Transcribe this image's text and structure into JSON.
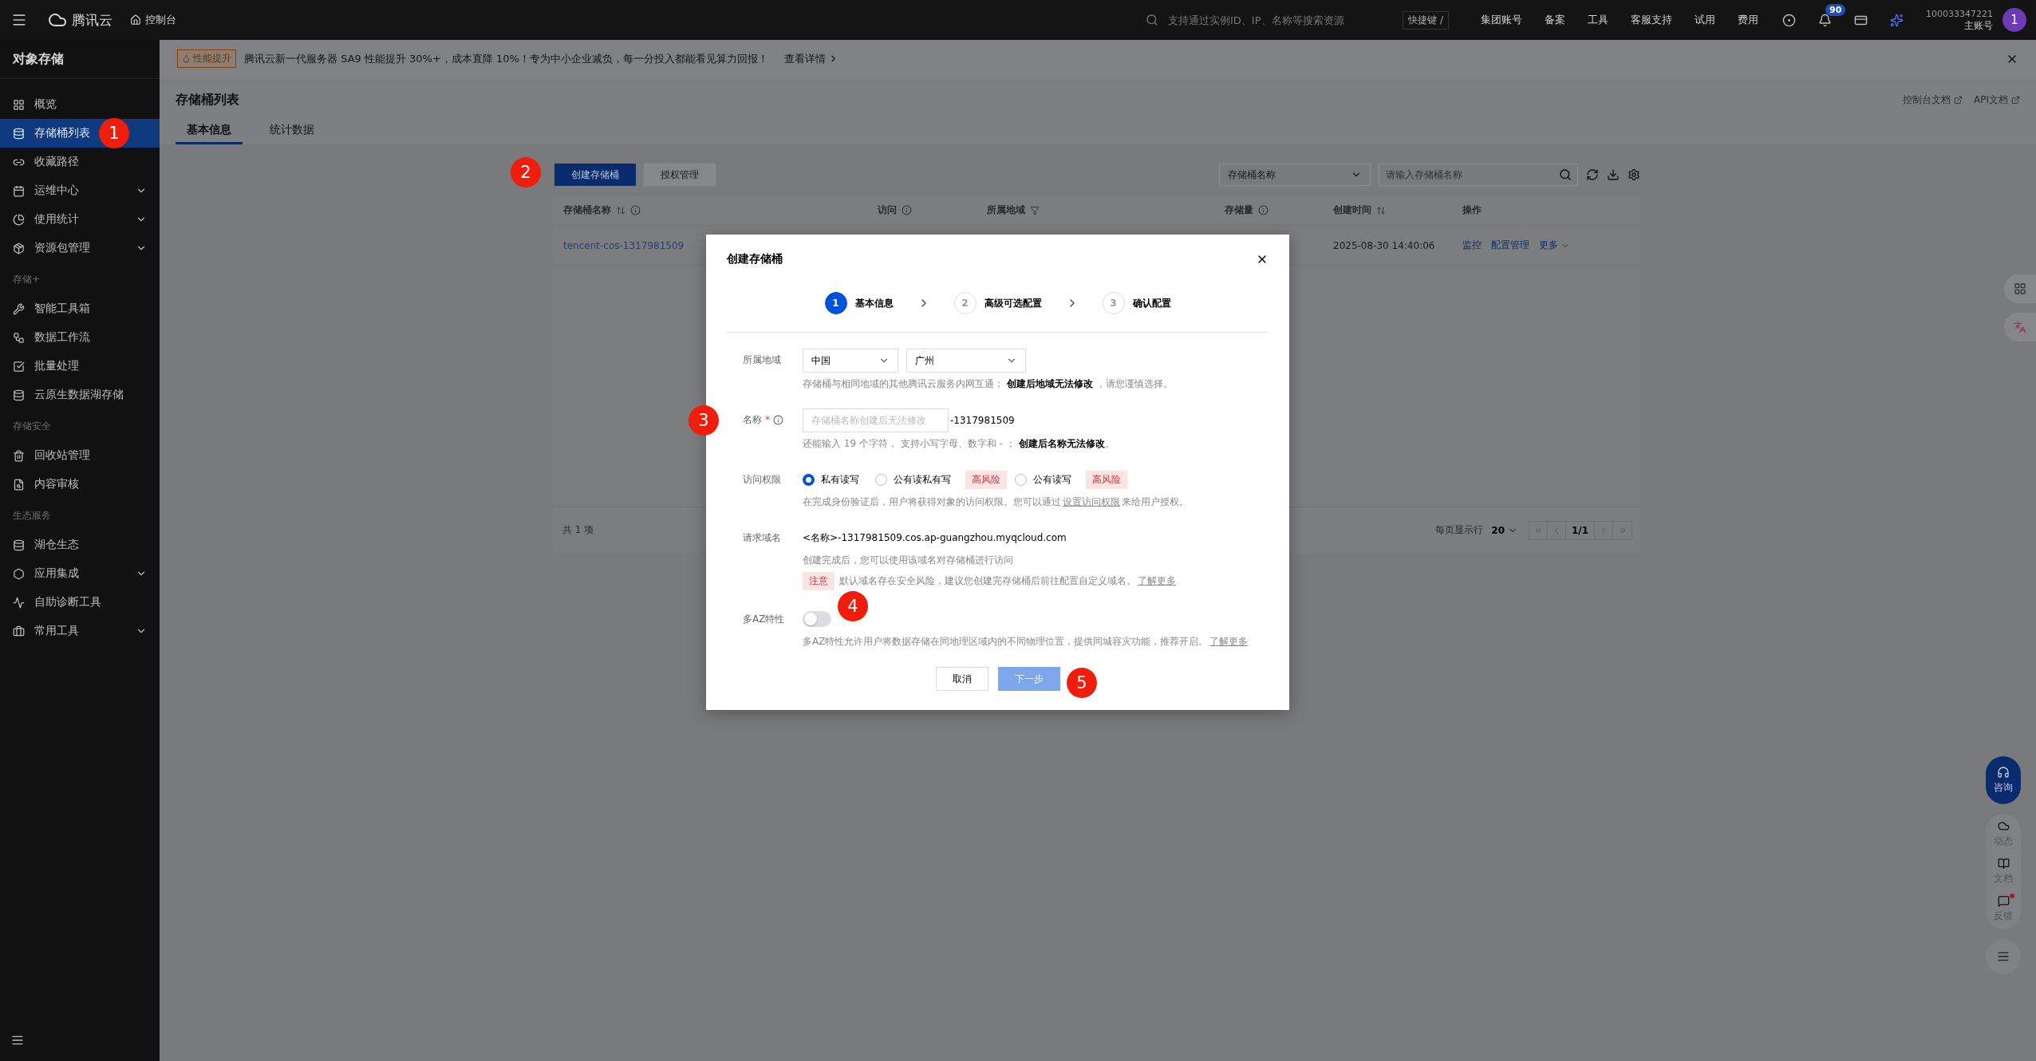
{
  "topbar": {
    "brand": "腾讯云",
    "console": "控制台",
    "search_placeholder": "支持通过实例ID、IP、名称等搜索资源",
    "shortcut": "快捷键 /",
    "links": [
      "集团账号",
      "备案",
      "工具",
      "客服支持",
      "试用",
      "费用"
    ],
    "notification_count": "90",
    "account_id": "100033347221",
    "account_role": "主账号",
    "avatar": "1"
  },
  "sidebar": {
    "title": "对象存储",
    "sections": [
      {
        "items": [
          {
            "label": "概览",
            "selected": false,
            "expandable": false
          },
          {
            "label": "存储桶列表",
            "selected": true,
            "expandable": false
          },
          {
            "label": "收藏路径",
            "selected": false,
            "expandable": false
          },
          {
            "label": "运维中心",
            "selected": false,
            "expandable": true
          },
          {
            "label": "使用统计",
            "selected": false,
            "expandable": true
          },
          {
            "label": "资源包管理",
            "selected": false,
            "expandable": true
          }
        ]
      },
      {
        "heading": "存储+",
        "items": [
          {
            "label": "智能工具箱",
            "selected": false,
            "expandable": false
          },
          {
            "label": "数据工作流",
            "selected": false,
            "expandable": false
          },
          {
            "label": "批量处理",
            "selected": false,
            "expandable": false
          },
          {
            "label": "云原生数据湖存储",
            "selected": false,
            "expandable": false
          }
        ]
      },
      {
        "heading": "存储安全",
        "items": [
          {
            "label": "回收站管理",
            "selected": false,
            "expandable": false
          },
          {
            "label": "内容审核",
            "selected": false,
            "expandable": false
          }
        ]
      },
      {
        "heading": "生态服务",
        "items": [
          {
            "label": "湖仓生态",
            "selected": false,
            "expandable": false
          },
          {
            "label": "应用集成",
            "selected": false,
            "expandable": true
          },
          {
            "label": "自助诊断工具",
            "selected": false,
            "expandable": false
          },
          {
            "label": "常用工具",
            "selected": false,
            "expandable": true
          }
        ]
      }
    ]
  },
  "banner": {
    "tag": "性能提升",
    "text": "腾讯云新一代服务器 SA9 性能提升 30%+，成本直降 10%！专为中小企业减负，每一分投入都能看见算力回报！",
    "link": "查看详情"
  },
  "page": {
    "title": "存储桶列表",
    "links": [
      "控制台文档",
      "API文档"
    ],
    "tabs": [
      {
        "label": "基本信息",
        "selected": true
      },
      {
        "label": "统计数据",
        "selected": false
      }
    ]
  },
  "toolbar": {
    "buttons": [
      {
        "label": "创建存储桶",
        "primary": true
      },
      {
        "label": "授权管理",
        "primary": false
      }
    ],
    "filter": "存储桶名称",
    "search_placeholder": "请输入存储桶名称"
  },
  "table": {
    "columns": [
      {
        "label": "存储桶名称",
        "sortable": true,
        "info": true,
        "filter": false
      },
      {
        "label": "访问",
        "sortable": false,
        "info": true,
        "filter": false
      },
      {
        "label": "所属地域",
        "sortable": false,
        "info": false,
        "filter": true
      },
      {
        "label": "存储量",
        "sortable": false,
        "info": true,
        "filter": false
      },
      {
        "label": "创建时间",
        "sortable": true,
        "info": false,
        "filter": false
      },
      {
        "label": "操作",
        "sortable": false,
        "info": false,
        "filter": false
      }
    ],
    "rows": [
      {
        "name": "tencent-cos-1317981509",
        "created": "2025-08-30 14:40:06",
        "actions": [
          "监控",
          "配置管理",
          "更多"
        ]
      }
    ],
    "total": "共 1 项",
    "page_size_label": "每页显示行",
    "page_size": "20",
    "page": "1/1"
  },
  "dialog": {
    "title": "创建存储桶",
    "steps": [
      {
        "number": "1",
        "label": "基本信息",
        "selected": true
      },
      {
        "number": "2",
        "label": "高级可选配置",
        "selected": false
      },
      {
        "number": "3",
        "label": "确认配置",
        "selected": false
      }
    ],
    "region": {
      "label": "所属地域",
      "selects": [
        "中国",
        "广州"
      ],
      "hint": "存储桶与相同地域的其他腾讯云服务内网互通； **创建后地域无法修改** ，请您谨慎选择。"
    },
    "name": {
      "label": "名称",
      "required": true,
      "required_mark": "*",
      "placeholder": "存储桶名称创建后无法修改",
      "suffix": "-1317981509",
      "hint": "还能输入 19 个字符， 支持小写字母、数字和 - ； **创建后名称无法修改**。"
    },
    "access": {
      "label": "访问权限",
      "options": [
        {
          "label": "私有读写",
          "selected": true
        },
        {
          "label": "公有读私有写",
          "selected": false,
          "risk": "高风险"
        },
        {
          "label": "公有读写",
          "selected": false,
          "risk": "高风险"
        }
      ],
      "hint": "在完成身份验证后，用户将获得对象的访问权限。您可以通过",
      "hint_link": "设置访问权限",
      "hint_after": "来给用户授权。"
    },
    "domain": {
      "label": "请求域名",
      "value": "<名称>-1317981509.cos.ap-guangzhou.myqcloud.com",
      "hint": "创建完成后，您可以使用该域名对存储桶进行访问",
      "notice_tag": "注意",
      "notice": "默认域名存在安全风险，建议您创建完存储桶后前往配置自定义域名。",
      "notice_link": "了解更多"
    },
    "multi_az": {
      "label": "多AZ特性",
      "on": false,
      "hint": "多AZ特性允许用户将数据存储在同地理区域内的不同物理位置，提供同城容灾功能，推荐开启。",
      "link": "了解更多"
    },
    "buttons": [
      {
        "label": "取消",
        "primary": false,
        "disabled": false
      },
      {
        "label": "下一步",
        "primary": true,
        "disabled": true
      }
    ]
  },
  "float_buttons": [
    {
      "label": "咨询",
      "kind": "primary"
    },
    {
      "label": "动态",
      "kind": "plain"
    },
    {
      "label": "文档",
      "kind": "plain"
    },
    {
      "label": "反馈",
      "kind": "plain",
      "dot": true
    }
  ],
  "markers": [
    "1",
    "2",
    "3",
    "4",
    "5"
  ]
}
